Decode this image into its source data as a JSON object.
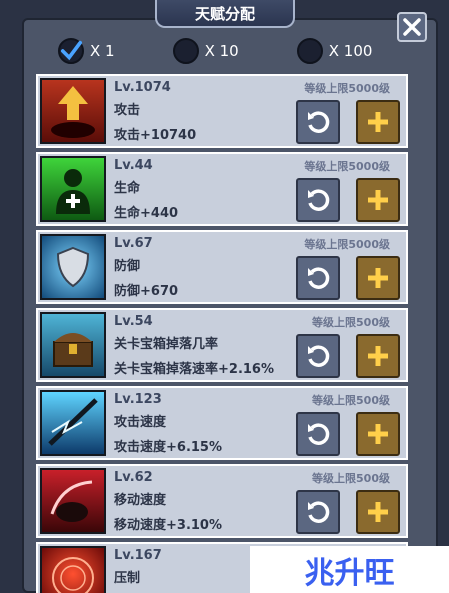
{
  "header": {
    "title": "天赋分配"
  },
  "toggles": [
    {
      "label": "X 1",
      "checked": true
    },
    {
      "label": "X 10",
      "checked": false
    },
    {
      "label": "X 100",
      "checked": false
    }
  ],
  "talents": [
    {
      "level": "Lv.1074",
      "name": "攻击",
      "stat": "攻击+10740",
      "cap": "等级上限5000级",
      "icon": "attack-icon"
    },
    {
      "level": "Lv.44",
      "name": "生命",
      "stat": "生命+440",
      "cap": "等级上限5000级",
      "icon": "life-icon"
    },
    {
      "level": "Lv.67",
      "name": "防御",
      "stat": "防御+670",
      "cap": "等级上限5000级",
      "icon": "defense-icon"
    },
    {
      "level": "Lv.54",
      "name": "关卡宝箱掉落几率",
      "stat": "关卡宝箱掉落速率+2.16%",
      "cap": "等级上限500级",
      "icon": "chest-icon"
    },
    {
      "level": "Lv.123",
      "name": "攻击速度",
      "stat": "攻击速度+6.15%",
      "cap": "等级上限500级",
      "icon": "attack-speed-icon"
    },
    {
      "level": "Lv.62",
      "name": "移动速度",
      "stat": "移动速度+3.10%",
      "cap": "等级上限500级",
      "icon": "move-speed-icon"
    },
    {
      "level": "Lv.167",
      "name": "压制",
      "stat": "",
      "cap": "",
      "icon": "suppress-icon"
    }
  ],
  "watermark": {
    "text": "兆升旺"
  },
  "colors": {
    "panel": "#4c5568",
    "row": "#c8cfdc",
    "add_button": "#8a6a2e",
    "reset_button": "#5b6781"
  }
}
